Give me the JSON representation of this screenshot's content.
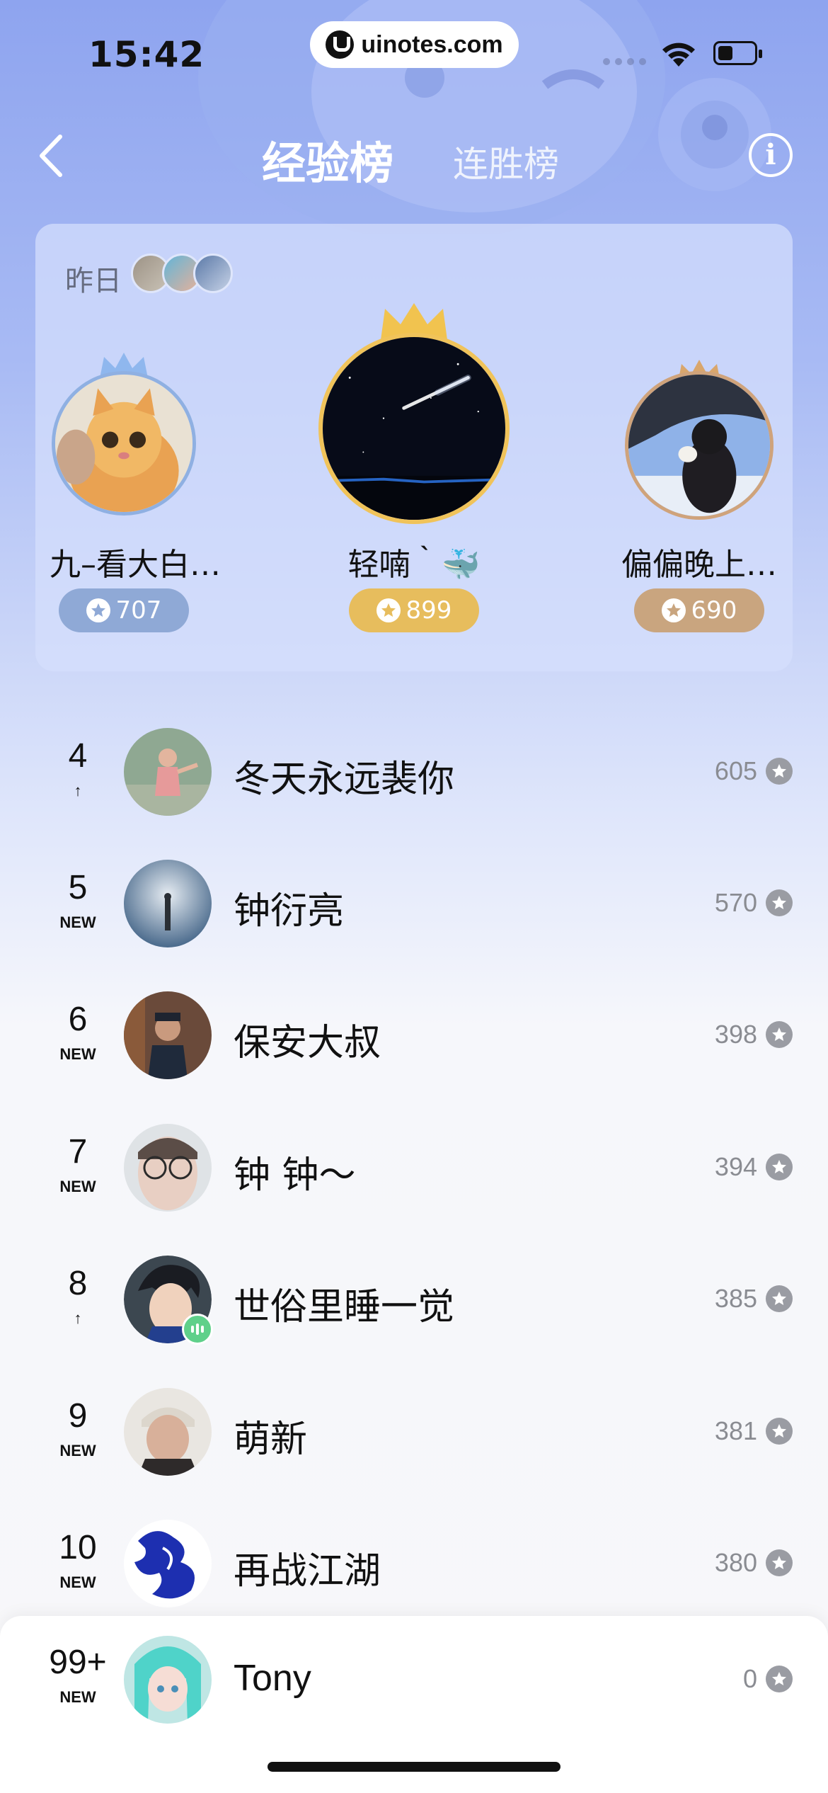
{
  "status_bar": {
    "time": "15:42",
    "url": "uinotes.com"
  },
  "nav": {
    "back_icon": "chevron-left-icon",
    "tabs": [
      {
        "label": "经验榜",
        "active": true
      },
      {
        "label": "连胜榜",
        "active": false
      }
    ],
    "info_icon": "info-icon",
    "info_glyph": "i"
  },
  "podium": {
    "yesterday_label": "昨日",
    "entries": [
      {
        "rank": 2,
        "name": "九–看大白…",
        "score": "707",
        "color": "#8fa9d6",
        "crown_color": "#8fb7ee"
      },
      {
        "rank": 1,
        "name": "轻喃｀🐳",
        "score": "899",
        "color": "#e7bd5d",
        "crown_color": "#f1c34f"
      },
      {
        "rank": 3,
        "name": "偏偏晚上…",
        "score": "690",
        "color": "#c9a57f",
        "crown_color": "#d9a66c"
      }
    ]
  },
  "ranking": [
    {
      "rank": "4",
      "change": "↑",
      "name": "冬天永远裴你",
      "score": "605"
    },
    {
      "rank": "5",
      "change": "NEW",
      "name": "钟衍亮",
      "score": "570"
    },
    {
      "rank": "6",
      "change": "NEW",
      "name": "保安大叔",
      "score": "398"
    },
    {
      "rank": "7",
      "change": "NEW",
      "name": "钟 钟～",
      "score": "394"
    },
    {
      "rank": "8",
      "change": "↑",
      "name": "世俗里睡一觉",
      "score": "385"
    },
    {
      "rank": "9",
      "change": "NEW",
      "name": "萌新",
      "score": "381"
    },
    {
      "rank": "10",
      "change": "NEW",
      "name": "再战江湖",
      "score": "380"
    }
  ],
  "self": {
    "rank": "99+",
    "change": "NEW",
    "name": "Tony",
    "score": "0"
  }
}
